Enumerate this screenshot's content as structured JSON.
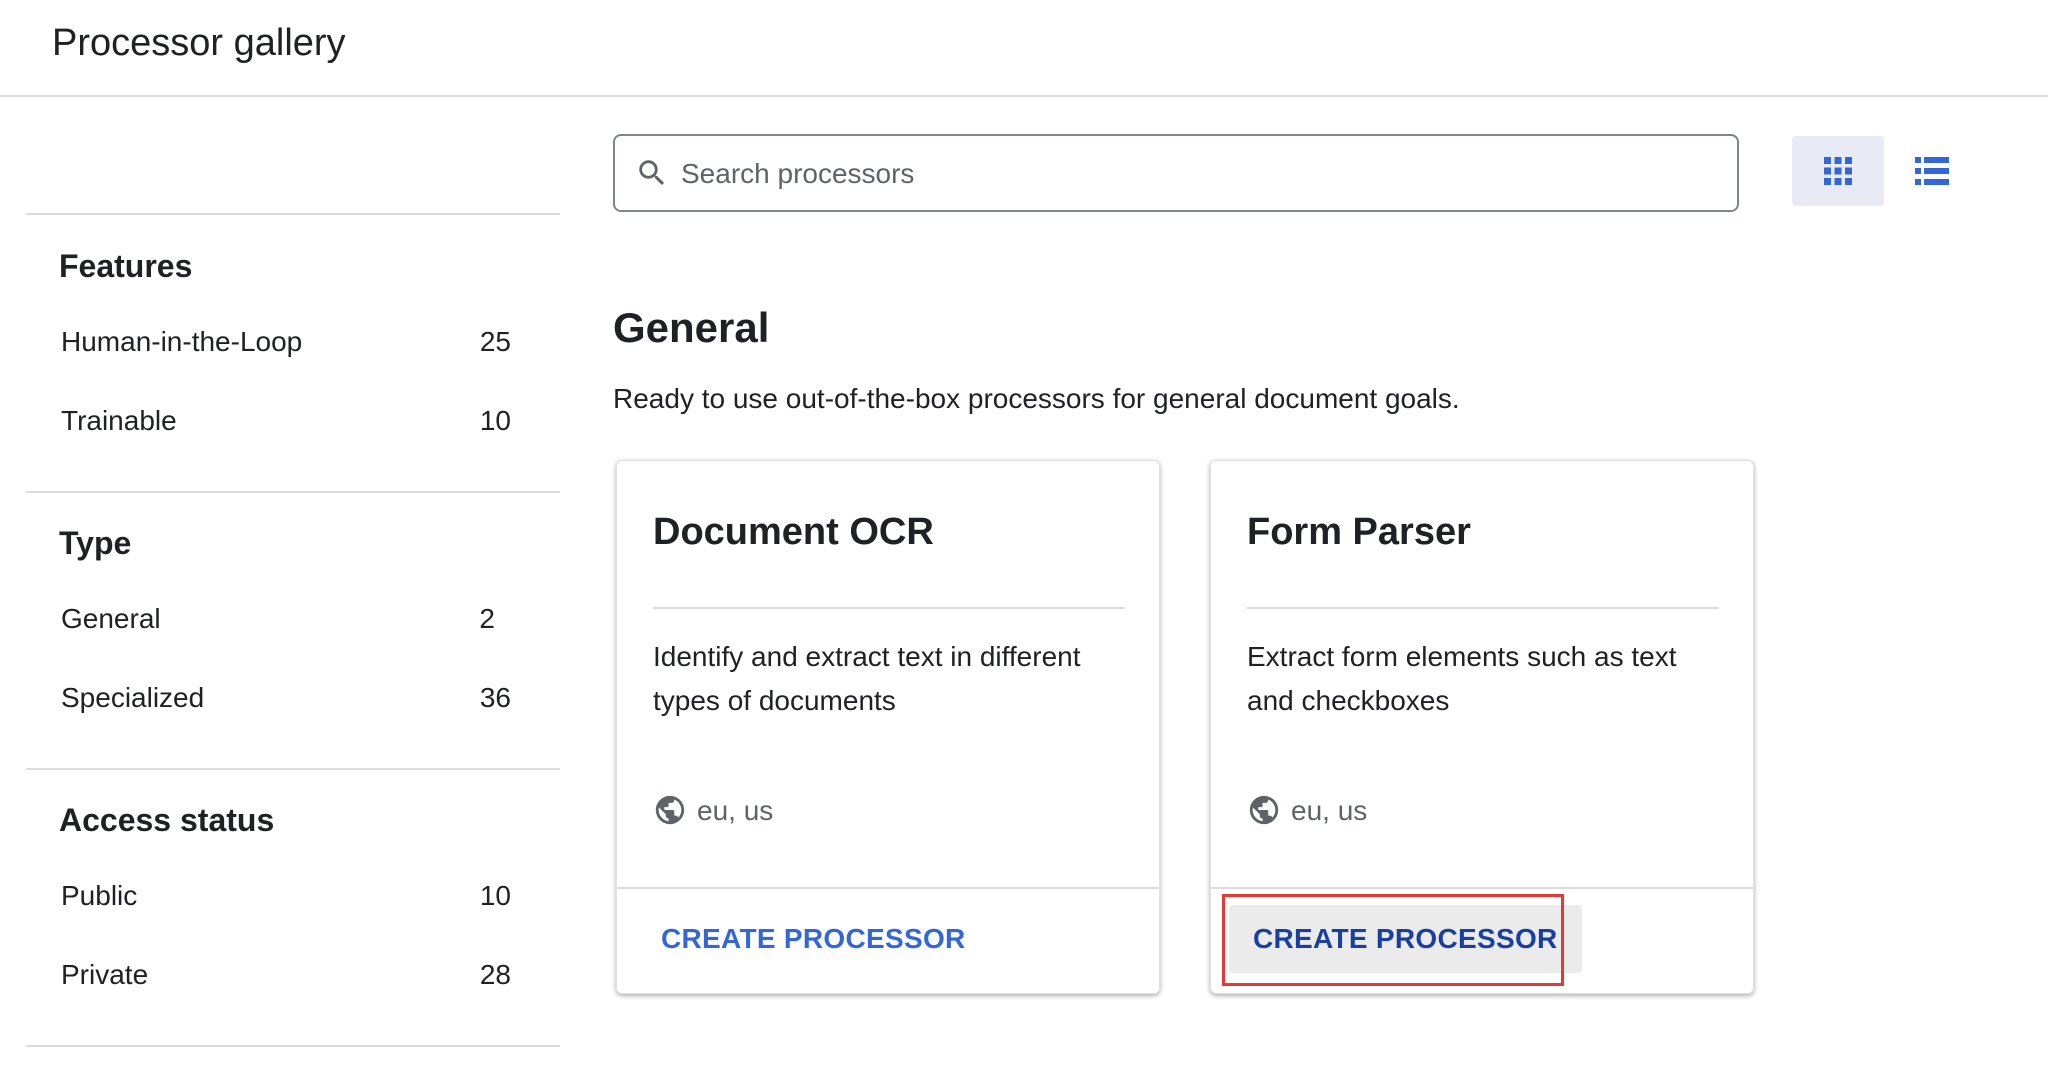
{
  "header": {
    "title": "Processor gallery"
  },
  "sidebar": {
    "sections": [
      {
        "title": "Features",
        "items": [
          {
            "label": "Human-in-the-Loop",
            "count": "25"
          },
          {
            "label": "Trainable",
            "count": "10"
          }
        ]
      },
      {
        "title": "Type",
        "items": [
          {
            "label": "General",
            "count": "2"
          },
          {
            "label": "Specialized",
            "count": "36"
          }
        ]
      },
      {
        "title": "Access status",
        "items": [
          {
            "label": "Public",
            "count": "10"
          },
          {
            "label": "Private",
            "count": "28"
          }
        ]
      }
    ]
  },
  "search": {
    "placeholder": "Search processors",
    "value": ""
  },
  "view_toggle": {
    "selected": "grid",
    "icons": [
      "grid-view-icon",
      "list-view-icon"
    ],
    "accent": "#3367d6",
    "selected_bg": "#e8eaf6"
  },
  "category": {
    "title": "General",
    "description": "Ready to use out-of-the-box processors for general document goals."
  },
  "cards": [
    {
      "title": "Document OCR",
      "description": "Identify and extract text in different types of documents",
      "regions": "eu, us",
      "button": "CREATE PROCESSOR"
    },
    {
      "title": "Form Parser",
      "description": "Extract form elements such as text and checkboxes",
      "regions": "eu, us",
      "button": "CREATE PROCESSOR"
    }
  ],
  "colors": {
    "button_text": "#3367d6",
    "highlight": "#e53935",
    "divider": "#dadce0"
  }
}
